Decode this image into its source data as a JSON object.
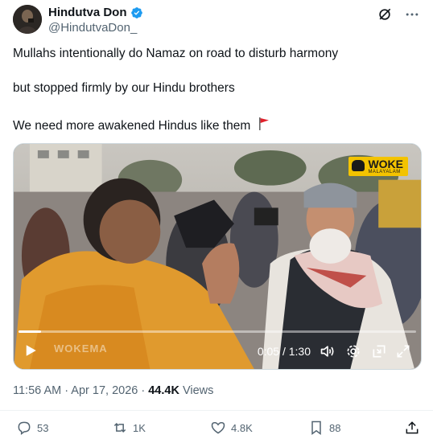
{
  "author": {
    "display_name": "Hindutva Don",
    "handle": "@HindutvaDon_",
    "avatar_icon": "avatar-photo",
    "verified_icon": "verified-badge-icon",
    "verified_color": "#1d9bf0"
  },
  "tweet": {
    "lines": [
      "Mullahs intentionally do Namaz on road to disturb harmony",
      "but stopped firmly by our Hindu brothers",
      "We need more awakened Hindus like them"
    ],
    "emoji_icon": "red-flag-icon"
  },
  "video": {
    "watermark_main": "WOKE",
    "watermark_sub": "MALAYALAM",
    "ghost_watermark": "WOKEMA",
    "time_display": "0:05 / 1:30",
    "progress": 0.056,
    "accent_color": "#f3c300"
  },
  "meta": {
    "time": "11:56 AM",
    "separator": " · ",
    "date": "Apr 17, 2026",
    "views_count": "44.4K",
    "views_label": " Views"
  },
  "actions": {
    "replies": "53",
    "reposts": "1K",
    "likes": "4.8K",
    "bookmarks": "88"
  }
}
